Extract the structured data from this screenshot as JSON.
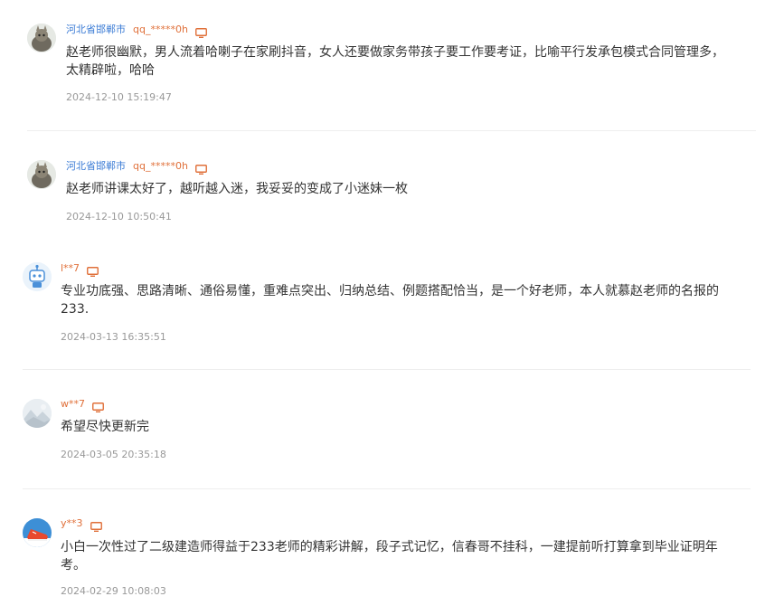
{
  "comments": [
    {
      "location": "河北省邯郸市",
      "user": "qq_*****0h",
      "text_line1": "赵老师很幽默，男人流着哈喇子在家刷抖音，女人还要做家务带孩子要工作要考证，比喻平行发承包模式合同管理多，",
      "text_line2": "太精辟啦，哈哈",
      "time": "2024-12-10 15:19:47",
      "avatar": "cat-avatar"
    },
    {
      "location": "河北省邯郸市",
      "user": "qq_*****0h",
      "text_line1": "赵老师讲课太好了，越听越入迷，我妥妥的变成了小迷妹一枚",
      "text_line2": "",
      "time": "2024-12-10 10:50:41",
      "avatar": "cat-avatar"
    },
    {
      "location": "",
      "user": "l**7",
      "text_line1": "专业功底强、思路清晰、通俗易懂，重难点突出、归纳总结、例题搭配恰当，是一个好老师，本人就慕赵老师的名报的",
      "text_line2": "233.",
      "time": "2024-03-13 16:35:51",
      "avatar": "robot-avatar"
    },
    {
      "location": "",
      "user": "w**7",
      "text_line1": "希望尽快更新完",
      "text_line2": "",
      "time": "2024-03-05 20:35:18",
      "avatar": "landscape-avatar"
    },
    {
      "location": "",
      "user": "y**3",
      "text_line1": "小白一次性过了二级建造师得益于233老师的精彩讲解，段子式记忆，信春哥不挂科，一建提前听打算拿到毕业证明年",
      "text_line2": "考。",
      "time": "2024-02-29 10:08:03",
      "avatar": "shoe-avatar"
    }
  ],
  "colors": {
    "location": "#3a7bd5",
    "user": "#e0703a",
    "text": "#333333",
    "time": "#999999"
  },
  "icons": {
    "device": "monitor-icon"
  }
}
